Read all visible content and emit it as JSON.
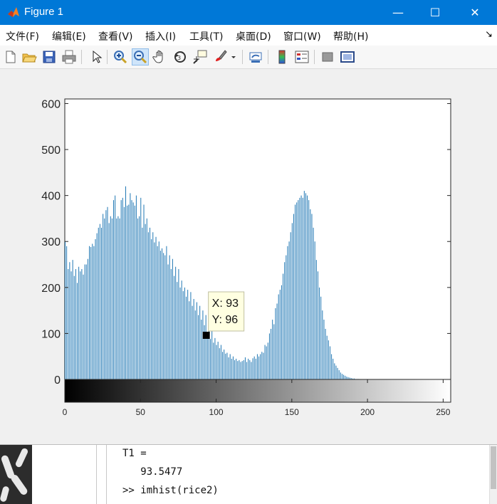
{
  "window": {
    "title": "Figure 1",
    "minimize_glyph": "—",
    "maximize_glyph": "☐",
    "close_glyph": "✕",
    "accent": "#0078d7"
  },
  "menubar": {
    "items": [
      {
        "label": "文件(F)"
      },
      {
        "label": "编辑(E)"
      },
      {
        "label": "查看(V)"
      },
      {
        "label": "插入(I)"
      },
      {
        "label": "工具(T)"
      },
      {
        "label": "桌面(D)"
      },
      {
        "label": "窗口(W)"
      },
      {
        "label": "帮助(H)"
      }
    ],
    "overflow_glyph": "↘"
  },
  "toolbar": {
    "icons": [
      "new-figure-icon",
      "open-file-icon",
      "save-icon",
      "print-icon",
      "edit-plot-arrow-icon",
      "zoom-in-icon",
      "zoom-out-icon",
      "pan-hand-icon",
      "rotate-3d-icon",
      "data-cursor-icon",
      "brush-icon",
      "link-plot-icon",
      "colorbar-icon",
      "legend-icon",
      "hide-plot-tools-icon",
      "show-plot-tools-icon"
    ],
    "active": "zoom-out-icon"
  },
  "datatip": {
    "x_text": "X: 93",
    "y_text": "Y: 96"
  },
  "chart_data": {
    "type": "bar",
    "title": "",
    "xlabel": "",
    "ylabel": "",
    "xlim": [
      0,
      255
    ],
    "ylim": [
      0,
      610
    ],
    "color": "#1f77b4",
    "y_ticks": [
      "0",
      "100",
      "200",
      "300",
      "400",
      "500",
      "600"
    ],
    "x_ticks": [
      "0",
      "50",
      "100",
      "150",
      "200",
      "250"
    ],
    "x": [
      0,
      1,
      2,
      3,
      4,
      5,
      6,
      7,
      8,
      9,
      10,
      11,
      12,
      13,
      14,
      15,
      16,
      17,
      18,
      19,
      20,
      21,
      22,
      23,
      24,
      25,
      26,
      27,
      28,
      29,
      30,
      31,
      32,
      33,
      34,
      35,
      36,
      37,
      38,
      39,
      40,
      41,
      42,
      43,
      44,
      45,
      46,
      47,
      48,
      49,
      50,
      51,
      52,
      53,
      54,
      55,
      56,
      57,
      58,
      59,
      60,
      61,
      62,
      63,
      64,
      65,
      66,
      67,
      68,
      69,
      70,
      71,
      72,
      73,
      74,
      75,
      76,
      77,
      78,
      79,
      80,
      81,
      82,
      83,
      84,
      85,
      86,
      87,
      88,
      89,
      90,
      91,
      92,
      93,
      94,
      95,
      96,
      97,
      98,
      99,
      100,
      101,
      102,
      103,
      104,
      105,
      106,
      107,
      108,
      109,
      110,
      111,
      112,
      113,
      114,
      115,
      116,
      117,
      118,
      119,
      120,
      121,
      122,
      123,
      124,
      125,
      126,
      127,
      128,
      129,
      130,
      131,
      132,
      133,
      134,
      135,
      136,
      137,
      138,
      139,
      140,
      141,
      142,
      143,
      144,
      145,
      146,
      147,
      148,
      149,
      150,
      151,
      152,
      153,
      154,
      155,
      156,
      157,
      158,
      159,
      160,
      161,
      162,
      163,
      164,
      165,
      166,
      167,
      168,
      169,
      170,
      171,
      172,
      173,
      174,
      175,
      176,
      177,
      178,
      179,
      180,
      181,
      182,
      183,
      184,
      185,
      186,
      187,
      188,
      189,
      190,
      191,
      192,
      193,
      194,
      195,
      196,
      197,
      198,
      199,
      200,
      201,
      202,
      203,
      204,
      205,
      206,
      207,
      208,
      209,
      210,
      211,
      212,
      213,
      214,
      215,
      216,
      217,
      218,
      219,
      220,
      221,
      222,
      223,
      224,
      225,
      226,
      227,
      228,
      229,
      230,
      231,
      232,
      233,
      234,
      235,
      236,
      237,
      238,
      239,
      240,
      241,
      242,
      243,
      244,
      245,
      246,
      247,
      248,
      249,
      250,
      251,
      252,
      253,
      254,
      255
    ],
    "values": [
      300,
      290,
      240,
      255,
      235,
      260,
      225,
      240,
      210,
      245,
      235,
      240,
      228,
      250,
      250,
      262,
      290,
      288,
      295,
      290,
      305,
      318,
      330,
      338,
      330,
      360,
      350,
      368,
      375,
      340,
      355,
      350,
      390,
      400,
      350,
      355,
      350,
      390,
      395,
      375,
      420,
      378,
      380,
      405,
      390,
      385,
      378,
      400,
      350,
      355,
      395,
      330,
      380,
      338,
      350,
      320,
      330,
      305,
      320,
      298,
      310,
      290,
      300,
      280,
      285,
      275,
      270,
      290,
      250,
      270,
      240,
      262,
      225,
      245,
      212,
      240,
      200,
      215,
      192,
      200,
      180,
      195,
      170,
      190,
      160,
      175,
      150,
      168,
      140,
      160,
      130,
      150,
      118,
      140,
      96,
      122,
      88,
      105,
      80,
      90,
      75,
      82,
      68,
      75,
      60,
      65,
      56,
      58,
      48,
      55,
      45,
      50,
      42,
      45,
      40,
      42,
      38,
      40,
      42,
      48,
      38,
      45,
      42,
      38,
      46,
      50,
      45,
      55,
      50,
      55,
      60,
      58,
      75,
      72,
      80,
      100,
      110,
      130,
      120,
      155,
      165,
      185,
      195,
      205,
      230,
      255,
      270,
      290,
      300,
      320,
      340,
      360,
      380,
      385,
      390,
      395,
      400,
      395,
      410,
      405,
      400,
      390,
      370,
      360,
      330,
      300,
      260,
      235,
      200,
      180,
      150,
      130,
      110,
      95,
      85,
      72,
      55,
      45,
      35,
      30,
      25,
      20,
      15,
      12,
      10,
      8,
      6,
      5,
      4,
      3,
      2,
      2,
      1,
      1,
      1,
      0,
      0,
      0,
      0,
      0,
      0,
      0,
      0,
      0,
      0,
      0,
      0,
      0,
      0,
      0,
      0,
      0,
      0,
      0,
      0,
      0,
      0,
      0,
      0,
      0,
      0,
      0,
      0,
      0,
      0,
      0,
      0,
      0,
      0,
      0,
      0,
      0,
      0,
      0,
      0,
      0,
      0,
      0,
      0,
      0,
      0,
      0,
      0,
      0,
      0,
      0,
      0,
      0,
      0,
      0,
      0,
      0,
      0,
      0,
      0,
      0,
      0,
      0,
      0,
      0,
      0,
      0,
      0,
      0,
      0,
      0,
      0,
      0,
      0,
      0,
      0,
      0,
      0,
      0
    ]
  },
  "command_window": {
    "lines": [
      "T1 =",
      "   93.5477",
      ">> imhist(rice2)"
    ]
  }
}
